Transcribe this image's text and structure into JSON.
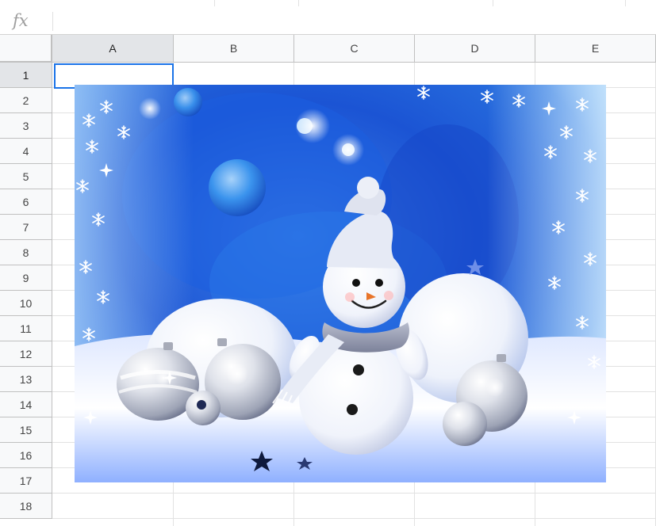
{
  "formula_bar": {
    "fx_label": "fx",
    "value": ""
  },
  "columns": [
    "A",
    "B",
    "C",
    "D",
    "E"
  ],
  "rows": [
    "1",
    "2",
    "3",
    "4",
    "5",
    "6",
    "7",
    "8",
    "9",
    "10",
    "11",
    "12",
    "13",
    "14",
    "15",
    "16",
    "17",
    "18"
  ],
  "selection": {
    "column": "A",
    "row": "1"
  },
  "picture": {
    "subject": "snowman with silver christmas ornaments on blue winter background",
    "colors": {
      "background_deep": "#1646c8",
      "background_light": "#5aa8f0",
      "snow": "#f4f7ff",
      "scarf": "#8a8fa6",
      "nose": "#e8742a",
      "ornament_silver": "#c9ccd6"
    }
  },
  "colors": {
    "selection_border": "#1a73e8",
    "header_bg": "#f8f9fa",
    "header_selected_bg": "#e3e5e8",
    "gridline": "#e2e2e2"
  }
}
